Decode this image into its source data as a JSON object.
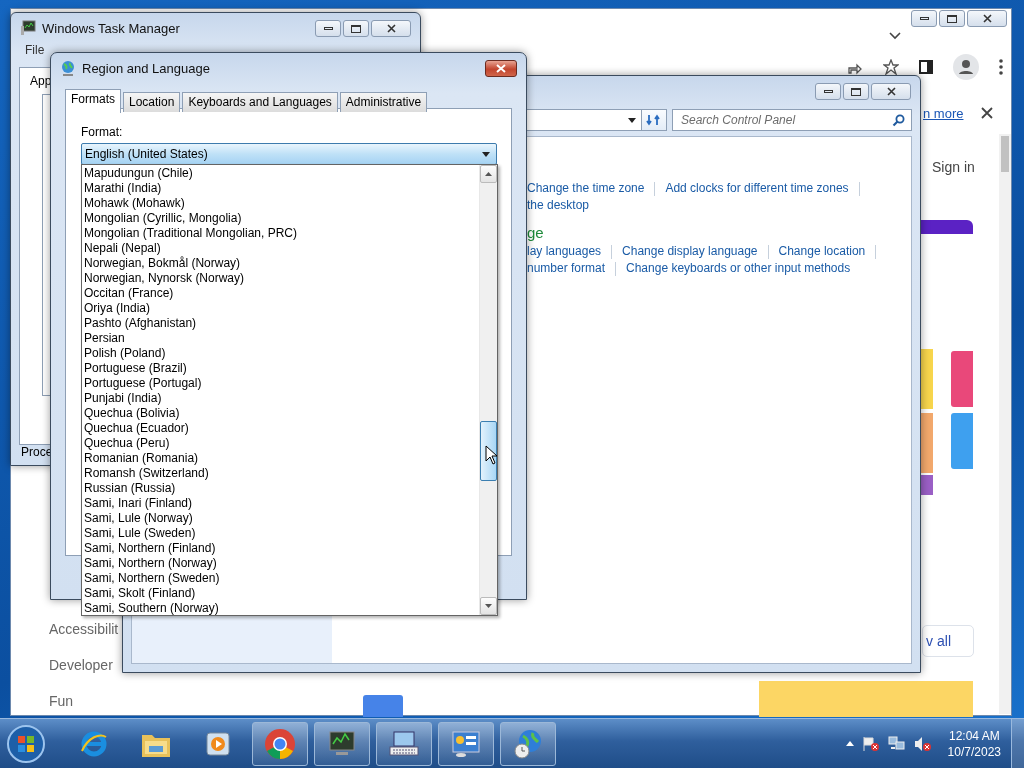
{
  "browser": {
    "banner_link": "n more",
    "sign_in": "Sign in",
    "sidebar_items": [
      "Accessibilit",
      "Developer",
      "Fun"
    ],
    "view_all": "v all"
  },
  "control_panel": {
    "search": {
      "placeholder": "Search Control Panel"
    },
    "groups": [
      {
        "rows": [
          {
            "links": [
              "Change the time zone",
              "Add clocks for different time zones"
            ],
            "trailing_divider": true
          },
          {
            "links": [
              "the desktop"
            ],
            "trailing_divider": false
          }
        ]
      },
      {
        "heading": "ge",
        "rows": [
          {
            "links": [
              "lay languages",
              "Change display language",
              "Change location"
            ],
            "trailing_divider": true
          },
          {
            "links": [
              "number format",
              "Change keyboards or other input methods"
            ],
            "trailing_divider": false
          }
        ]
      }
    ]
  },
  "task_manager": {
    "title": "Windows Task Manager",
    "menu": [
      "File"
    ],
    "tab": "App",
    "footer": "Proce"
  },
  "dialog": {
    "title": "Region and Language",
    "tabs": [
      {
        "label": "Formats",
        "selected": true
      },
      {
        "label": "Location",
        "selected": false
      },
      {
        "label": "Keyboards and Languages",
        "selected": false
      },
      {
        "label": "Administrative",
        "selected": false
      }
    ],
    "format_label": "Format:",
    "format_value": "English (United States)",
    "options": [
      "Mapudungun (Chile)",
      "Marathi (India)",
      "Mohawk (Mohawk)",
      "Mongolian (Cyrillic, Mongolia)",
      "Mongolian (Traditional Mongolian, PRC)",
      "Nepali (Nepal)",
      "Norwegian, Bokmål (Norway)",
      "Norwegian, Nynorsk (Norway)",
      "Occitan (France)",
      "Oriya (India)",
      "Pashto (Afghanistan)",
      "Persian",
      "Polish (Poland)",
      "Portuguese (Brazil)",
      "Portuguese (Portugal)",
      "Punjabi (India)",
      "Quechua (Bolivia)",
      "Quechua (Ecuador)",
      "Quechua (Peru)",
      "Romanian (Romania)",
      "Romansh (Switzerland)",
      "Russian (Russia)",
      "Sami, Inari (Finland)",
      "Sami, Lule (Norway)",
      "Sami, Lule (Sweden)",
      "Sami, Northern (Finland)",
      "Sami, Northern (Norway)",
      "Sami, Northern (Sweden)",
      "Sami, Skolt (Finland)",
      "Sami, Southern (Norway)"
    ]
  },
  "taskbar": {
    "apps": [
      {
        "kind": "ie",
        "running": false
      },
      {
        "kind": "folder",
        "running": false
      },
      {
        "kind": "media",
        "running": false
      },
      {
        "kind": "chrome",
        "running": true
      },
      {
        "kind": "monitor",
        "running": true
      },
      {
        "kind": "keyboard",
        "running": true
      },
      {
        "kind": "panel",
        "running": true
      },
      {
        "kind": "globe",
        "running": true
      }
    ],
    "time": "12:04 AM",
    "date": "10/7/2023"
  }
}
